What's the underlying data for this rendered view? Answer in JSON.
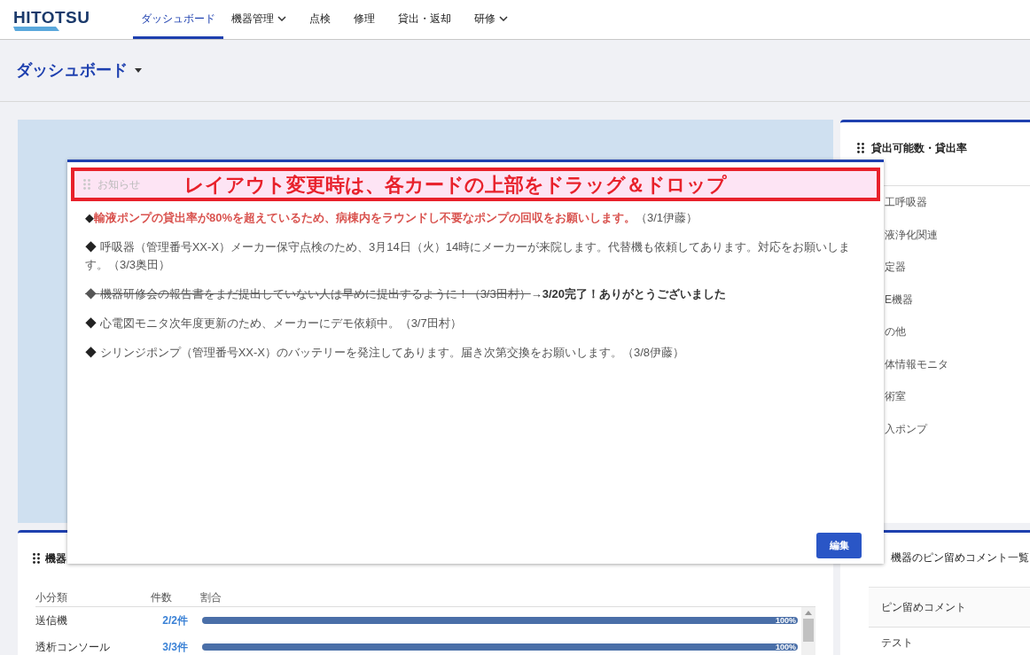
{
  "header": {
    "logo": "HITOTSU",
    "nav": [
      {
        "label": "ダッシュボード",
        "selected": true,
        "dropdown": false
      },
      {
        "label": "機器管理",
        "selected": false,
        "dropdown": true
      },
      {
        "label": "点検",
        "selected": false,
        "dropdown": false
      },
      {
        "label": "修理",
        "selected": false,
        "dropdown": false
      },
      {
        "label": "貸出・返却",
        "selected": false,
        "dropdown": false
      },
      {
        "label": "研修",
        "selected": false,
        "dropdown": true
      }
    ]
  },
  "page_title": "ダッシュボード",
  "rental_card": {
    "title": "貸出可能数・貸出率",
    "items": [
      "工呼吸器",
      "液浄化関連",
      "定器",
      "E機器",
      "の他",
      "体情報モニタ",
      "術室",
      "入ポンプ"
    ]
  },
  "equipment_card": {
    "title": "機器",
    "columns": [
      "小分類",
      "件数",
      "割合"
    ],
    "rows": [
      {
        "name": "送信機",
        "count": "2/2件",
        "level": 1,
        "reading": "100%"
      },
      {
        "name": "透析コンソール",
        "count": "3/3件",
        "level": 1,
        "reading": "100%"
      }
    ]
  },
  "pin_card": {
    "title": "機器のピン留めコメント一覧",
    "column": "ピン留めコメント",
    "rows": [
      "テスト"
    ]
  },
  "notice_card": {
    "title": "お知らせ",
    "banner": "レイアウト変更時は、各カードの上部をドラッグ＆ドロップ",
    "edit_button": "編集",
    "items": [
      {
        "kind": "alert",
        "bullet": "◆",
        "text": "輸液ポンプの貸出率が80%を超えているため、病棟内をラウンドし不要なポンプの回収をお願いします。",
        "note": "（3/1伊藤）"
      },
      {
        "kind": "normal",
        "bullet": "◆",
        "text": "呼吸器（管理番号XX-X）メーカー保守点検のため、3月14日（火）14時にメーカーが来院します。代替機も依頼してあります。対応をお願いします。（3/3奥田）"
      },
      {
        "kind": "done",
        "bullet": "◆",
        "text": "機器研修会の報告書をまだ提出していない人は早めに提出するように！（3/3田村）",
        "note": "→3/20完了！ありがとうございました"
      },
      {
        "kind": "normal",
        "bullet": "◆",
        "text": "心電図モニタ次年度更新のため、メーカーにデモ依頼中。（3/7田村）"
      },
      {
        "kind": "normal",
        "bullet": "◆",
        "text": "シリンジポンプ（管理番号XX-X）のバッテリーを発注してあります。届き次第交換をお願いします。（3/8伊藤）"
      }
    ]
  }
}
